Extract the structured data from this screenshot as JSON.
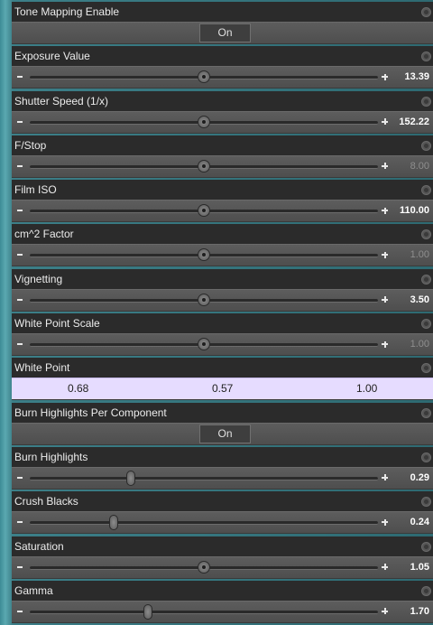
{
  "properties": [
    {
      "kind": "toggle",
      "label": "Tone Mapping Enable",
      "value": "On"
    },
    {
      "kind": "slider",
      "label": "Exposure Value",
      "value": "13.39",
      "fraction": 0.5,
      "dim": false
    },
    {
      "kind": "slider",
      "label": "Shutter Speed (1/x)",
      "value": "152.22",
      "fraction": 0.5,
      "dim": false
    },
    {
      "kind": "slider",
      "label": "F/Stop",
      "value": "8.00",
      "fraction": 0.5,
      "dim": true
    },
    {
      "kind": "slider",
      "label": "Film ISO",
      "value": "110.00",
      "fraction": 0.5,
      "dim": false
    },
    {
      "kind": "slider",
      "label": "cm^2 Factor",
      "value": "1.00",
      "fraction": 0.5,
      "dim": true
    },
    {
      "kind": "slider",
      "label": "Vignetting",
      "value": "3.50",
      "fraction": 0.5,
      "dim": false
    },
    {
      "kind": "slider",
      "label": "White Point Scale",
      "value": "1.00",
      "fraction": 0.5,
      "dim": true
    },
    {
      "kind": "color",
      "label": "White Point",
      "components": [
        "0.68",
        "0.57",
        "1.00"
      ],
      "color": "#e6dcff"
    },
    {
      "kind": "toggle",
      "label": "Burn Highlights Per Component",
      "value": "On"
    },
    {
      "kind": "slider",
      "label": "Burn Highlights",
      "value": "0.29",
      "fraction": 0.29,
      "dim": false,
      "handle": "pill"
    },
    {
      "kind": "slider",
      "label": "Crush Blacks",
      "value": "0.24",
      "fraction": 0.24,
      "dim": false,
      "handle": "pill"
    },
    {
      "kind": "slider",
      "label": "Saturation",
      "value": "1.05",
      "fraction": 0.5,
      "dim": false
    },
    {
      "kind": "slider",
      "label": "Gamma",
      "value": "1.70",
      "fraction": 0.34,
      "dim": false,
      "handle": "pill"
    }
  ]
}
